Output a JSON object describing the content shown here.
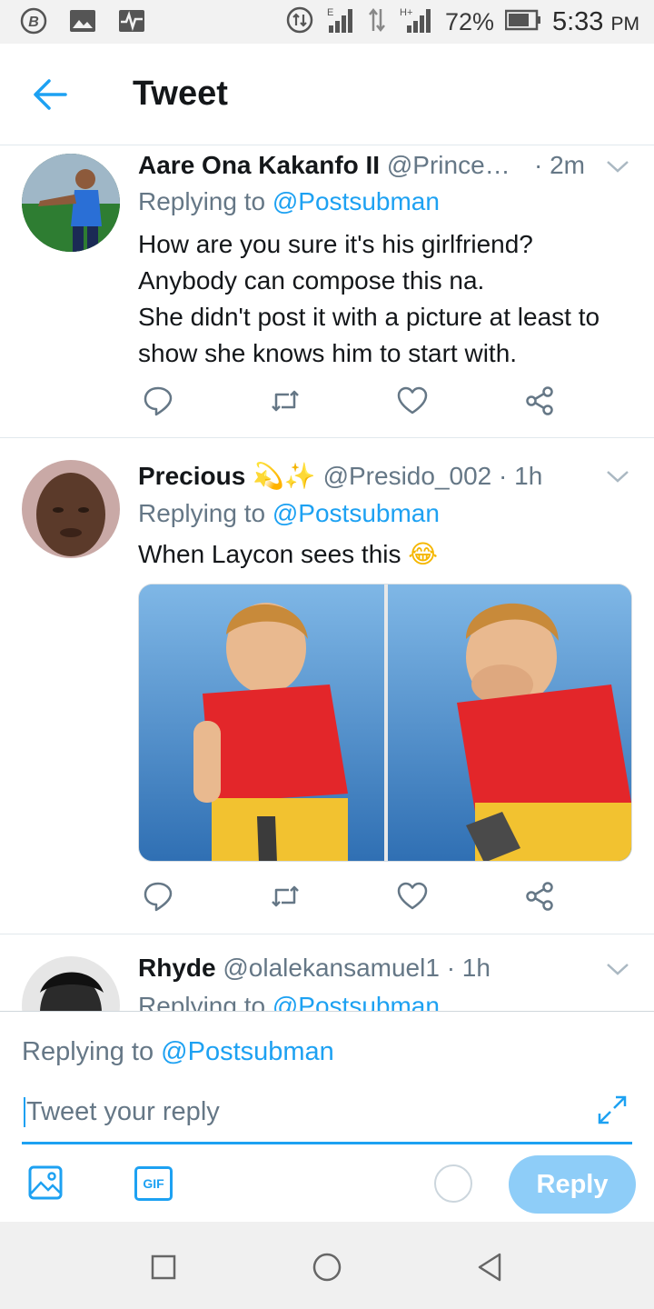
{
  "status_bar": {
    "left_icons": [
      "b-badge-icon",
      "image-icon",
      "activity-icon"
    ],
    "battery": "72%",
    "time": "5:33",
    "time_suffix": "PM",
    "network_labels": [
      "E",
      "H+"
    ]
  },
  "header": {
    "title": "Tweet"
  },
  "tweets": [
    {
      "name": "Aare Ona Kakanfo II",
      "handle": "@Prince…",
      "time": "· 2m",
      "replying_prefix": "Replying to",
      "replying_to": "@Postsubman",
      "lines": [
        "How are you sure it's his girlfriend?",
        "Anybody can compose this na.",
        "She didn't post it with a picture at least to show she knows him to start with."
      ]
    },
    {
      "name": "Precious",
      "name_emoji": "💫✨",
      "handle": "@Presido_002",
      "time": "· 1h",
      "replying_prefix": "Replying to",
      "replying_to": "@Postsubman",
      "text": "When Laycon sees this",
      "text_emoji": "😂"
    },
    {
      "name": "Rhyde",
      "handle": "@olalekansamuel1",
      "time": "· 1h",
      "replying_prefix": "Replying to",
      "replying_to": "@Postsubman"
    }
  ],
  "composer": {
    "replying_prefix": "Replying to",
    "replying_to": "@Postsubman",
    "placeholder": "Tweet your reply",
    "gif_label": "GIF",
    "reply_label": "Reply"
  },
  "colors": {
    "accent": "#1da1f2",
    "reply_button": "#8ecdf8",
    "secondary_text": "#657786",
    "divider": "#e1e8ed"
  }
}
